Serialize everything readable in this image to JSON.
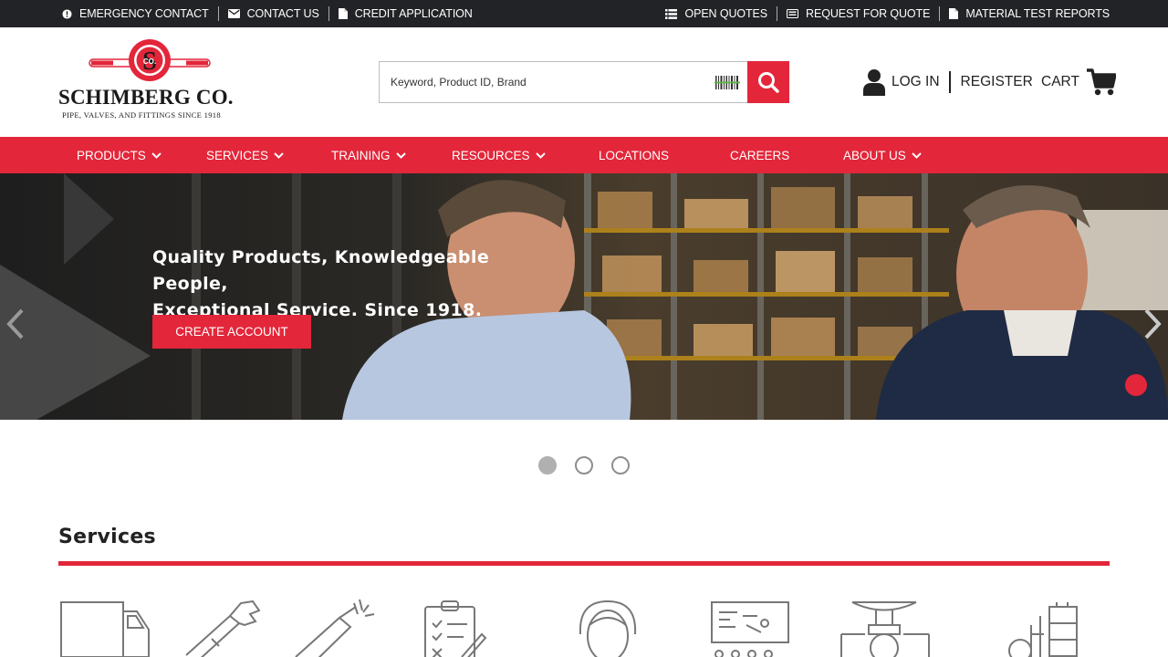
{
  "topbar": {
    "left": [
      {
        "label": "EMERGENCY CONTACT",
        "icon": "alert-circle-icon"
      },
      {
        "label": "CONTACT US",
        "icon": "envelope-icon"
      },
      {
        "label": "CREDIT APPLICATION",
        "icon": "document-icon"
      }
    ],
    "right": [
      {
        "label": "OPEN QUOTES",
        "icon": "list-icon"
      },
      {
        "label": "REQUEST FOR QUOTE",
        "icon": "card-icon"
      },
      {
        "label": "MATERIAL TEST REPORTS",
        "icon": "document-icon"
      }
    ]
  },
  "header": {
    "logo": {
      "monogram": "S",
      "small": "CO.",
      "wordmark": "SCHIMBERG CO.",
      "tagline": "PIPE, VALVES, AND FITTINGS SINCE 1918"
    },
    "search": {
      "placeholder": "Keyword, Product ID, Brand",
      "value": ""
    },
    "login": "LOG IN",
    "register": "REGISTER",
    "cart": "CART"
  },
  "nav": [
    {
      "label": "PRODUCTS",
      "dropdown": true
    },
    {
      "label": "SERVICES",
      "dropdown": true
    },
    {
      "label": "TRAINING",
      "dropdown": true
    },
    {
      "label": "RESOURCES",
      "dropdown": true
    },
    {
      "label": "LOCATIONS",
      "dropdown": false
    },
    {
      "label": "CAREERS",
      "dropdown": false
    },
    {
      "label": "ABOUT US",
      "dropdown": true
    }
  ],
  "hero": {
    "headline_line1": "Quality Products, Knowledgeable People,",
    "headline_line2": "Exceptional Service. Since 1918.",
    "cta": "CREATE ACCOUNT",
    "slides_total": 3,
    "active_slide": 1
  },
  "services": {
    "title": "Services",
    "icons": [
      "delivery-truck-icon",
      "pipe-wrench-icon",
      "cutting-tool-icon",
      "clipboard-checklist-icon",
      "headset-support-icon",
      "training-presentation-icon",
      "valve-icon",
      "forklift-warehouse-icon"
    ]
  },
  "colors": {
    "brand_red": "#e3263a",
    "topbar": "#222326"
  }
}
